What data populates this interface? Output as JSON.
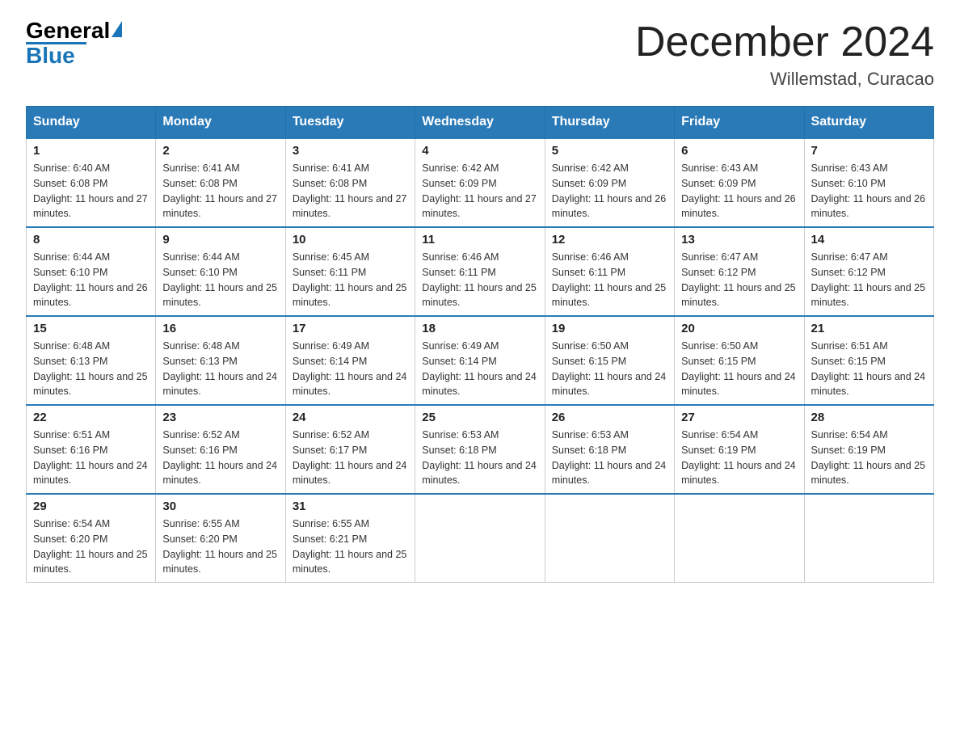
{
  "header": {
    "logo_general": "General",
    "logo_blue": "Blue",
    "title": "December 2024",
    "subtitle": "Willemstad, Curacao"
  },
  "weekdays": [
    "Sunday",
    "Monday",
    "Tuesday",
    "Wednesday",
    "Thursday",
    "Friday",
    "Saturday"
  ],
  "weeks": [
    [
      {
        "day": "1",
        "sunrise": "6:40 AM",
        "sunset": "6:08 PM",
        "daylight": "11 hours and 27 minutes."
      },
      {
        "day": "2",
        "sunrise": "6:41 AM",
        "sunset": "6:08 PM",
        "daylight": "11 hours and 27 minutes."
      },
      {
        "day": "3",
        "sunrise": "6:41 AM",
        "sunset": "6:08 PM",
        "daylight": "11 hours and 27 minutes."
      },
      {
        "day": "4",
        "sunrise": "6:42 AM",
        "sunset": "6:09 PM",
        "daylight": "11 hours and 27 minutes."
      },
      {
        "day": "5",
        "sunrise": "6:42 AM",
        "sunset": "6:09 PM",
        "daylight": "11 hours and 26 minutes."
      },
      {
        "day": "6",
        "sunrise": "6:43 AM",
        "sunset": "6:09 PM",
        "daylight": "11 hours and 26 minutes."
      },
      {
        "day": "7",
        "sunrise": "6:43 AM",
        "sunset": "6:10 PM",
        "daylight": "11 hours and 26 minutes."
      }
    ],
    [
      {
        "day": "8",
        "sunrise": "6:44 AM",
        "sunset": "6:10 PM",
        "daylight": "11 hours and 26 minutes."
      },
      {
        "day": "9",
        "sunrise": "6:44 AM",
        "sunset": "6:10 PM",
        "daylight": "11 hours and 25 minutes."
      },
      {
        "day": "10",
        "sunrise": "6:45 AM",
        "sunset": "6:11 PM",
        "daylight": "11 hours and 25 minutes."
      },
      {
        "day": "11",
        "sunrise": "6:46 AM",
        "sunset": "6:11 PM",
        "daylight": "11 hours and 25 minutes."
      },
      {
        "day": "12",
        "sunrise": "6:46 AM",
        "sunset": "6:11 PM",
        "daylight": "11 hours and 25 minutes."
      },
      {
        "day": "13",
        "sunrise": "6:47 AM",
        "sunset": "6:12 PM",
        "daylight": "11 hours and 25 minutes."
      },
      {
        "day": "14",
        "sunrise": "6:47 AM",
        "sunset": "6:12 PM",
        "daylight": "11 hours and 25 minutes."
      }
    ],
    [
      {
        "day": "15",
        "sunrise": "6:48 AM",
        "sunset": "6:13 PM",
        "daylight": "11 hours and 25 minutes."
      },
      {
        "day": "16",
        "sunrise": "6:48 AM",
        "sunset": "6:13 PM",
        "daylight": "11 hours and 24 minutes."
      },
      {
        "day": "17",
        "sunrise": "6:49 AM",
        "sunset": "6:14 PM",
        "daylight": "11 hours and 24 minutes."
      },
      {
        "day": "18",
        "sunrise": "6:49 AM",
        "sunset": "6:14 PM",
        "daylight": "11 hours and 24 minutes."
      },
      {
        "day": "19",
        "sunrise": "6:50 AM",
        "sunset": "6:15 PM",
        "daylight": "11 hours and 24 minutes."
      },
      {
        "day": "20",
        "sunrise": "6:50 AM",
        "sunset": "6:15 PM",
        "daylight": "11 hours and 24 minutes."
      },
      {
        "day": "21",
        "sunrise": "6:51 AM",
        "sunset": "6:15 PM",
        "daylight": "11 hours and 24 minutes."
      }
    ],
    [
      {
        "day": "22",
        "sunrise": "6:51 AM",
        "sunset": "6:16 PM",
        "daylight": "11 hours and 24 minutes."
      },
      {
        "day": "23",
        "sunrise": "6:52 AM",
        "sunset": "6:16 PM",
        "daylight": "11 hours and 24 minutes."
      },
      {
        "day": "24",
        "sunrise": "6:52 AM",
        "sunset": "6:17 PM",
        "daylight": "11 hours and 24 minutes."
      },
      {
        "day": "25",
        "sunrise": "6:53 AM",
        "sunset": "6:18 PM",
        "daylight": "11 hours and 24 minutes."
      },
      {
        "day": "26",
        "sunrise": "6:53 AM",
        "sunset": "6:18 PM",
        "daylight": "11 hours and 24 minutes."
      },
      {
        "day": "27",
        "sunrise": "6:54 AM",
        "sunset": "6:19 PM",
        "daylight": "11 hours and 24 minutes."
      },
      {
        "day": "28",
        "sunrise": "6:54 AM",
        "sunset": "6:19 PM",
        "daylight": "11 hours and 25 minutes."
      }
    ],
    [
      {
        "day": "29",
        "sunrise": "6:54 AM",
        "sunset": "6:20 PM",
        "daylight": "11 hours and 25 minutes."
      },
      {
        "day": "30",
        "sunrise": "6:55 AM",
        "sunset": "6:20 PM",
        "daylight": "11 hours and 25 minutes."
      },
      {
        "day": "31",
        "sunrise": "6:55 AM",
        "sunset": "6:21 PM",
        "daylight": "11 hours and 25 minutes."
      },
      null,
      null,
      null,
      null
    ]
  ]
}
